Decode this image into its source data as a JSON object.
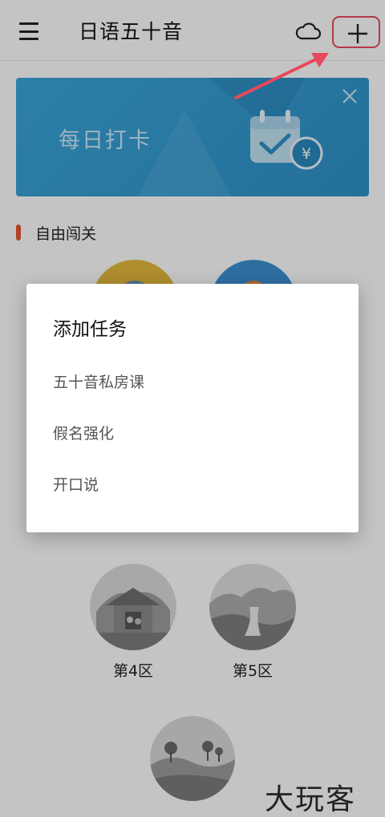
{
  "topbar": {
    "title": "日语五十音"
  },
  "banner": {
    "text": "每日打卡"
  },
  "section": {
    "title": "自由闯关"
  },
  "zones": [
    {
      "label": "第4区"
    },
    {
      "label": "第5区"
    }
  ],
  "dialog": {
    "title": "添加任务",
    "items": [
      {
        "label": "五十音私房课"
      },
      {
        "label": "假名强化"
      },
      {
        "label": "开口说"
      }
    ]
  },
  "watermark": "大玩客",
  "colors": {
    "accent_red": "#e8485b",
    "banner_blue": "#3aa4d8",
    "section_marker": "#e0562e"
  }
}
